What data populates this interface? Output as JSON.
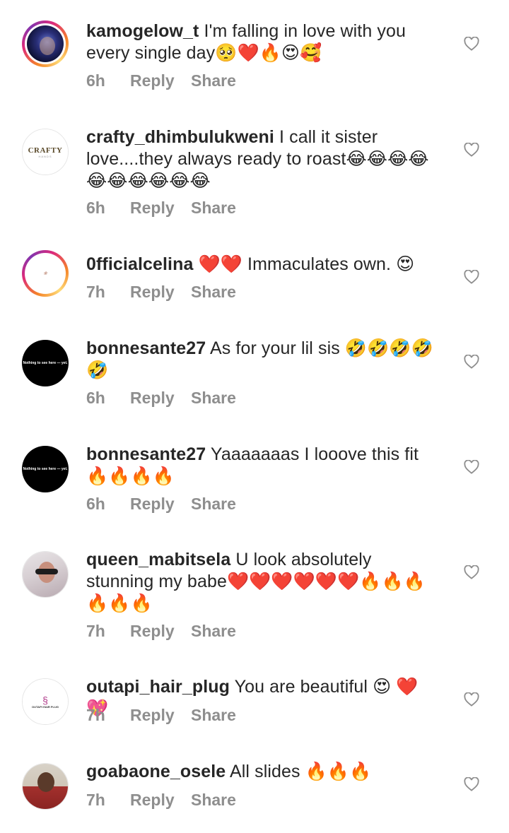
{
  "comments": [
    {
      "username": "kamogelow_t",
      "text": "I'm falling in love with you every single day🥺❤️🔥😍🥰",
      "time": "6h",
      "reply_label": "Reply",
      "share_label": "Share",
      "avatar": "photo-avatar-story-ring"
    },
    {
      "username": "crafty_dhimbulukweni",
      "text": "I call it sister love....they always ready to roast😂😂😂😂😂😂😂😂😂😂",
      "time": "6h",
      "reply_label": "Reply",
      "share_label": "Share",
      "avatar": "crafty-hands-logo",
      "avatar_logo_text": "CRAFTY",
      "avatar_logo_sub": "HANDS"
    },
    {
      "username": "0fficialcelina",
      "text": "❤️❤️ Immaculates own. 😍",
      "time": "7h",
      "reply_label": "Reply",
      "share_label": "Share",
      "avatar": "celina-logo-story-ring"
    },
    {
      "username": "bonnesante27",
      "text": "As for your lil sis 🤣🤣🤣🤣🤣",
      "time": "6h",
      "reply_label": "Reply",
      "share_label": "Share",
      "avatar": "nothing-to-see-avatar",
      "avatar_text": "Nothing to see here — yet."
    },
    {
      "username": "bonnesante27",
      "text": "Yaaaaaaas I looove this fit 🔥🔥🔥🔥",
      "time": "6h",
      "reply_label": "Reply",
      "share_label": "Share",
      "avatar": "nothing-to-see-avatar",
      "avatar_text": "Nothing to see here — yet."
    },
    {
      "username": "queen_mabitsela",
      "text": "U look absolutely stunning my babe❤️❤️❤️❤️❤️❤️🔥🔥🔥🔥🔥🔥",
      "time": "7h",
      "reply_label": "Reply",
      "share_label": "Share",
      "avatar": "photo-avatar"
    },
    {
      "username": "outapi_hair_plug",
      "text": "You are beautiful 😍 ❤️ 💖",
      "time": "7h",
      "reply_label": "Reply",
      "share_label": "Share",
      "avatar": "outapi-logo",
      "avatar_logo_text": "OUTAPI HAIR PLUG"
    },
    {
      "username": "goabaone_osele",
      "text": "All slides 🔥🔥🔥",
      "time": "7h",
      "reply_label": "Reply",
      "share_label": "Share",
      "avatar": "photo-avatar"
    }
  ],
  "colors": {
    "text": "#262626",
    "meta": "#8e8e8e",
    "heart_outline": "#8e8e8e"
  },
  "icons": {
    "like": "heart-outline-icon"
  }
}
